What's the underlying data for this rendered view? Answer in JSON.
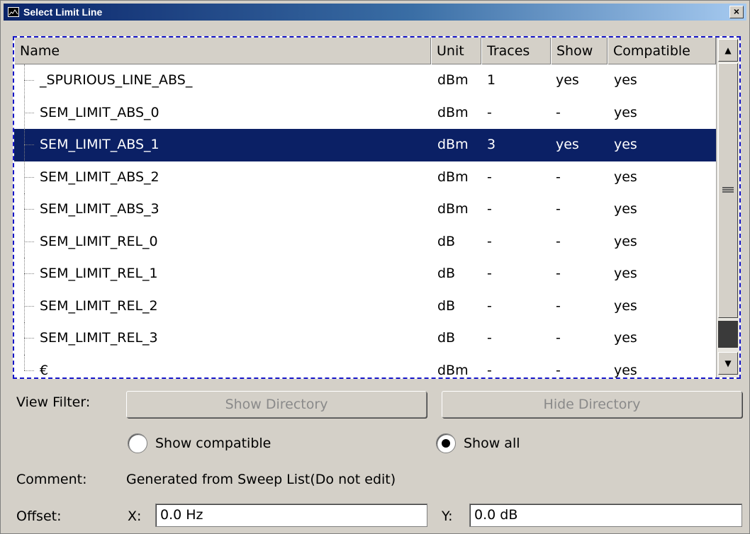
{
  "window": {
    "title": "Select Limit Line",
    "close_label": "×"
  },
  "table": {
    "columns": [
      "Name",
      "Unit",
      "Traces",
      "Show",
      "Compatible"
    ],
    "rows": [
      {
        "name": "_SPURIOUS_LINE_ABS_",
        "unit": "dBm",
        "traces": "1",
        "show": "yes",
        "compatible": "yes"
      },
      {
        "name": "SEM_LIMIT_ABS_0",
        "unit": "dBm",
        "traces": "-",
        "show": "-",
        "compatible": "yes"
      },
      {
        "name": "SEM_LIMIT_ABS_1",
        "unit": "dBm",
        "traces": "3",
        "show": "yes",
        "compatible": "yes",
        "selected": true
      },
      {
        "name": "SEM_LIMIT_ABS_2",
        "unit": "dBm",
        "traces": "-",
        "show": "-",
        "compatible": "yes"
      },
      {
        "name": "SEM_LIMIT_ABS_3",
        "unit": "dBm",
        "traces": "-",
        "show": "-",
        "compatible": "yes"
      },
      {
        "name": "SEM_LIMIT_REL_0",
        "unit": "dB",
        "traces": "-",
        "show": "-",
        "compatible": "yes"
      },
      {
        "name": "SEM_LIMIT_REL_1",
        "unit": "dB",
        "traces": "-",
        "show": "-",
        "compatible": "yes"
      },
      {
        "name": "SEM_LIMIT_REL_2",
        "unit": "dB",
        "traces": "-",
        "show": "-",
        "compatible": "yes"
      },
      {
        "name": "SEM_LIMIT_REL_3",
        "unit": "dB",
        "traces": "-",
        "show": "-",
        "compatible": "yes"
      },
      {
        "name": "€",
        "unit": "dBm",
        "traces": "-",
        "show": "-",
        "compatible": "yes"
      }
    ]
  },
  "scrollbar": {
    "up_glyph": "▲",
    "down_glyph": "▼"
  },
  "view_filter": {
    "label": "View Filter:",
    "show_directory": "Show Directory",
    "hide_directory": "Hide Directory",
    "show_compatible": "Show compatible",
    "show_all": "Show all",
    "selected": "show_all"
  },
  "comment": {
    "label": "Comment:",
    "value": "Generated from Sweep List(Do not edit)"
  },
  "offset": {
    "label": "Offset:",
    "x_label": "X:",
    "x_value": "0.0 Hz",
    "y_label": "Y:",
    "y_value": "0.0 dB"
  },
  "colors": {
    "selection": "#0b2065",
    "focus_border": "#1515c8",
    "title_start": "#0a246a",
    "title_end": "#a6caf0"
  }
}
